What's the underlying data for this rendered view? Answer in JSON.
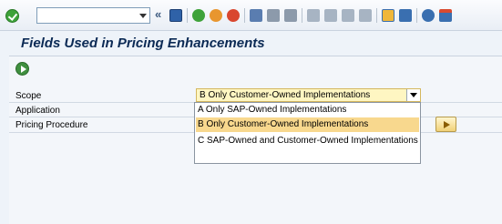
{
  "toolbar": {
    "command_field": {
      "value": ""
    },
    "icons": [
      "ok-icon",
      "back-icon",
      "save-icon",
      "navigate-back-icon",
      "exit-icon",
      "cancel-icon",
      "print-icon",
      "find-icon",
      "find-next-icon",
      "first-page-icon",
      "previous-page-icon",
      "next-page-icon",
      "last-page-icon",
      "create-session-icon",
      "shortcut-icon",
      "help-icon",
      "customize-layout-icon"
    ]
  },
  "page": {
    "title": "Fields Used in Pricing Enhancements"
  },
  "form": {
    "scope_label": "Scope",
    "application_label": "Application",
    "pricing_procedure_label": "Pricing Procedure",
    "scope_value": "B Only Customer-Owned Implementations",
    "scope_options": [
      "A Only SAP-Owned Implementations",
      "B  Only Customer-Owned Implementations",
      "C SAP-Owned and Customer-Owned Implementations"
    ],
    "selected_option_index": 1
  },
  "colors": {
    "title": "#0b2a55",
    "field_highlight": "#fef6c2",
    "selected_option": "#f8d88e"
  }
}
